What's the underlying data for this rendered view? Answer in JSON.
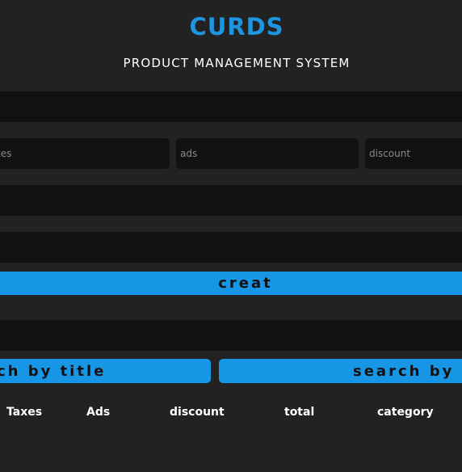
{
  "header": {
    "title": "CURDS",
    "subtitle": "PRODUCT MANAGEMENT SYSTEM"
  },
  "form": {
    "taxes_placeholder": "taxes",
    "ads_placeholder": "ads",
    "discount_placeholder": "discount",
    "create_label": "creat"
  },
  "search": {
    "by_title_label": "search by title",
    "by_category_label": "search by category"
  },
  "table": {
    "headers": [
      "Taxes",
      "Ads",
      "discount",
      "total",
      "category"
    ]
  }
}
